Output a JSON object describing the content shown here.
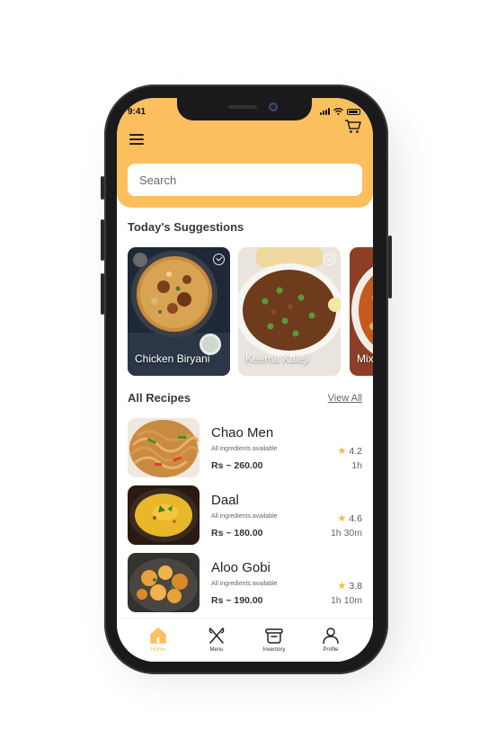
{
  "status_bar": {
    "time": "9:41"
  },
  "header": {
    "menu_icon": "hamburger-icon",
    "cart_icon": "cart-icon",
    "accent_color": "#fcbf5e"
  },
  "search": {
    "placeholder": "Search"
  },
  "suggestions": {
    "title": "Today's Suggestions",
    "items": [
      {
        "label": "Chicken Biryani"
      },
      {
        "label": "Keema Kaleji"
      },
      {
        "label": "Mix"
      }
    ]
  },
  "recipes": {
    "title": "All Recipes",
    "view_all": "View All",
    "items": [
      {
        "name": "Chao Men",
        "availability": "All ingredients available",
        "price": "Rs ~ 260.00",
        "rating": "4.2",
        "time": "1h"
      },
      {
        "name": "Daal",
        "availability": "All ingredients available",
        "price": "Rs ~ 180.00",
        "rating": "4.6",
        "time": "1h 30m"
      },
      {
        "name": "Aloo Gobi",
        "availability": "All ingredients available",
        "price": "Rs ~ 190.00",
        "rating": "3.8",
        "time": "1h 10m"
      }
    ]
  },
  "bottom_nav": {
    "items": [
      {
        "label": "Home",
        "icon": "home-icon",
        "active": true
      },
      {
        "label": "Menu",
        "icon": "utensils-icon",
        "active": false
      },
      {
        "label": "Inventory",
        "icon": "pot-icon",
        "active": false
      },
      {
        "label": "Profile",
        "icon": "person-icon",
        "active": false
      }
    ]
  }
}
